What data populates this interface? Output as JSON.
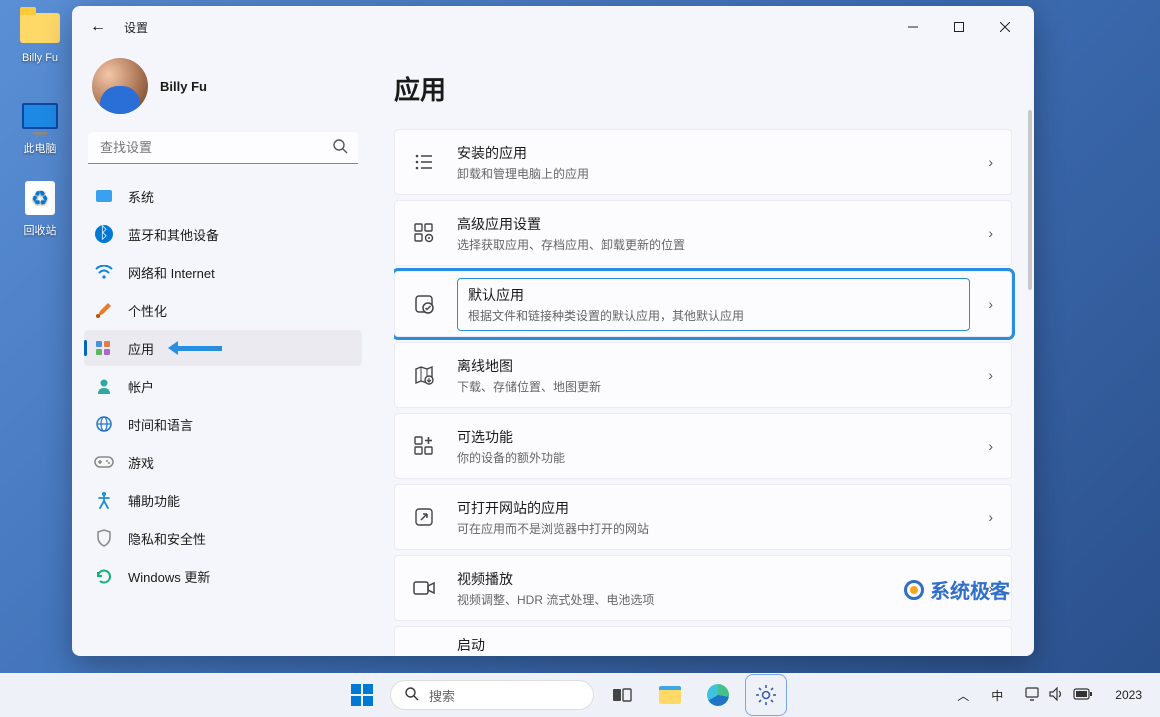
{
  "desktop": {
    "folder_label": "Billy Fu",
    "pc_label": "此电脑",
    "bin_label": "回收站"
  },
  "window": {
    "title": "设置",
    "profile": {
      "name": "Billy Fu",
      "sub": ""
    },
    "search_placeholder": "查找设置"
  },
  "sidebar": {
    "items": [
      {
        "label": "系统"
      },
      {
        "label": "蓝牙和其他设备"
      },
      {
        "label": "网络和 Internet"
      },
      {
        "label": "个性化"
      },
      {
        "label": "应用"
      },
      {
        "label": "帐户"
      },
      {
        "label": "时间和语言"
      },
      {
        "label": "游戏"
      },
      {
        "label": "辅助功能"
      },
      {
        "label": "隐私和安全性"
      },
      {
        "label": "Windows 更新"
      }
    ]
  },
  "page": {
    "title": "应用",
    "cards": [
      {
        "title": "安装的应用",
        "sub": "卸载和管理电脑上的应用"
      },
      {
        "title": "高级应用设置",
        "sub": "选择获取应用、存档应用、卸载更新的位置"
      },
      {
        "title": "默认应用",
        "sub": "根据文件和链接种类设置的默认应用，其他默认应用"
      },
      {
        "title": "离线地图",
        "sub": "下载、存储位置、地图更新"
      },
      {
        "title": "可选功能",
        "sub": "你的设备的额外功能"
      },
      {
        "title": "可打开网站的应用",
        "sub": "可在应用而不是浏览器中打开的网站"
      },
      {
        "title": "视频播放",
        "sub": "视频调整、HDR 流式处理、电池选项"
      },
      {
        "title": "启动",
        "sub": ""
      }
    ]
  },
  "watermark": "系统极客",
  "taskbar": {
    "search_placeholder": "搜索",
    "ime": "中",
    "clock": "2023"
  }
}
